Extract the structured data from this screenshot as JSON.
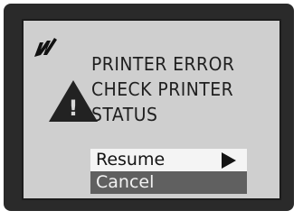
{
  "app_logo": {
    "icon": "canon-logo-icon"
  },
  "dialog": {
    "warning_icon": "warning-triangle-icon",
    "message_lines": [
      "PRINTER ERROR",
      "CHECK PRINTER",
      "STATUS"
    ]
  },
  "menu": {
    "items": [
      {
        "label": "Resume",
        "icon": "arrow-right-icon",
        "selected": false
      },
      {
        "label": "Cancel",
        "selected": true
      }
    ]
  },
  "colors": {
    "bezel": "#2a2a2a",
    "screen": "#cfcfcf",
    "highlight": "#606060"
  }
}
